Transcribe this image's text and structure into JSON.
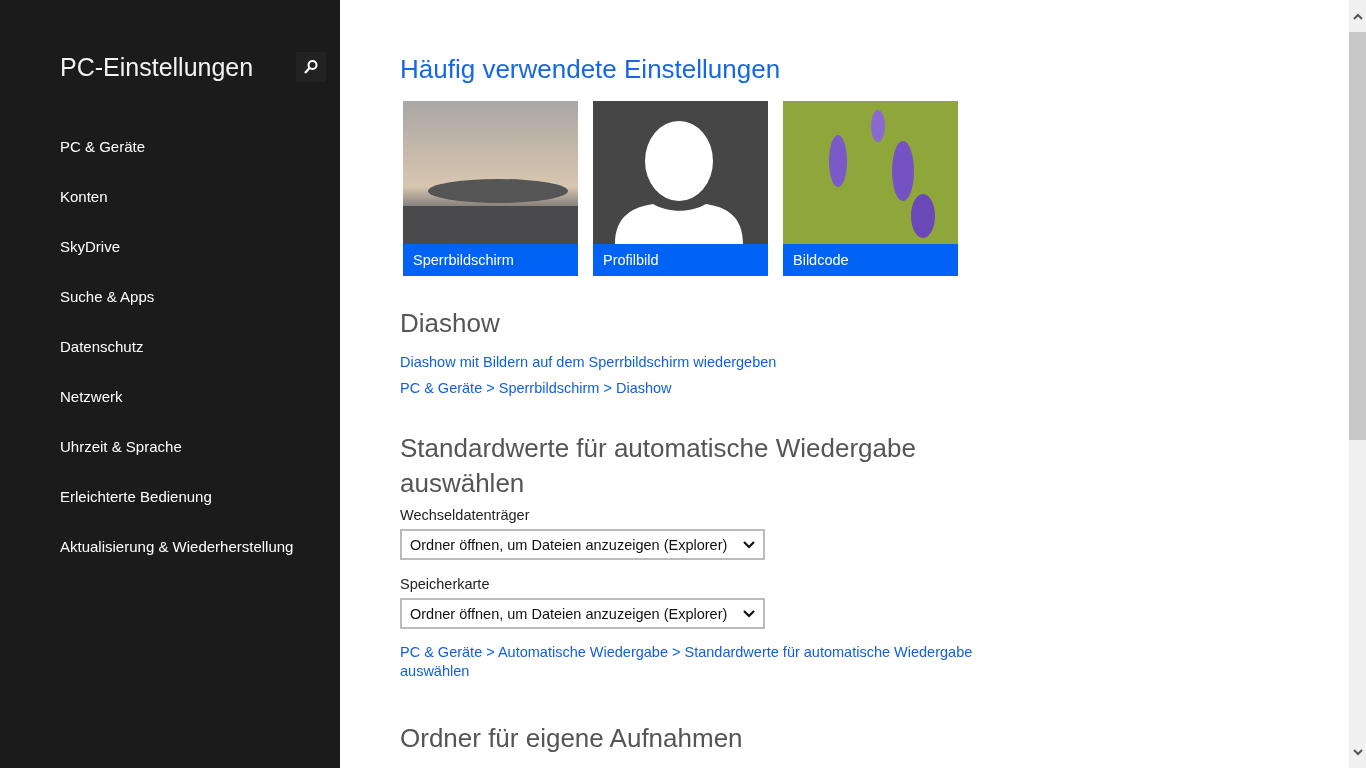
{
  "sidebar": {
    "title": "PC-Einstellungen",
    "items": [
      {
        "label": "PC & Geräte",
        "selected": false
      },
      {
        "label": "Konten",
        "selected": false
      },
      {
        "label": "SkyDrive",
        "selected": false
      },
      {
        "label": "Suche & Apps",
        "selected": false
      },
      {
        "label": "Datenschutz",
        "selected": false
      },
      {
        "label": "Netzwerk",
        "selected": false
      },
      {
        "label": "Uhrzeit & Sprache",
        "selected": false
      },
      {
        "label": "Erleichterte Bedienung",
        "selected": false
      },
      {
        "label": "Aktualisierung & Wiederherstellung",
        "selected": false
      }
    ]
  },
  "sections": [
    {
      "kind": "tiles",
      "title": "Häufig verwendete Einstellungen",
      "tiles": [
        {
          "label": "Sperrbildschirm",
          "kind": "sky"
        },
        {
          "label": "Profilbild",
          "kind": "avatar"
        },
        {
          "label": "Bildcode",
          "kind": "flowers"
        }
      ]
    },
    {
      "kind": "links",
      "title": "Diashow",
      "links": [
        "Diashow mit Bildern auf dem Sperrbildschirm wiedergeben",
        "PC & Geräte > Sperrbildschirm > Diashow"
      ]
    },
    {
      "kind": "dropdowns",
      "title": "Standardwerte für automatische Wiedergabe auswählen",
      "fields": [
        {
          "label": "Wechseldatenträger",
          "value": "Ordner öffnen, um Dateien anzuzeigen (Explorer)"
        },
        {
          "label": "Speicherkarte",
          "value": "Ordner öffnen, um Dateien anzuzeigen (Explorer)"
        }
      ],
      "links": [
        "PC & Geräte > Automatische Wiedergabe > Standardwerte für automatische Wiedergabe auswählen"
      ]
    },
    {
      "kind": "heading",
      "title": "Ordner für eigene Aufnahmen"
    }
  ]
}
